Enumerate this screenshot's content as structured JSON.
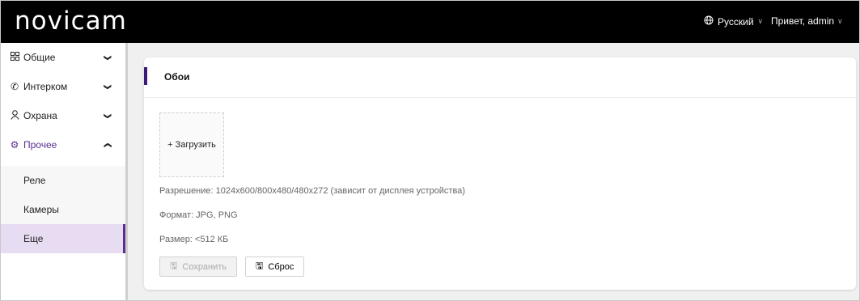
{
  "header": {
    "logo": "novicam",
    "language": "Русский",
    "greeting": "Привет, admin"
  },
  "sidebar": {
    "items": [
      {
        "label": "Общие",
        "icon": "grid-icon"
      },
      {
        "label": "Интерком",
        "icon": "handset-icon"
      },
      {
        "label": "Охрана",
        "icon": "person-icon"
      },
      {
        "label": "Прочее",
        "icon": "gear-icon"
      }
    ],
    "subitems": [
      {
        "label": "Реле"
      },
      {
        "label": "Камеры"
      },
      {
        "label": "Еще"
      }
    ]
  },
  "card": {
    "title": "Обои",
    "upload_label": "+ Загрузить",
    "resolution": "Разрешение: 1024x600/800x480/480x272 (зависит от дисплея устройства)",
    "format": "Формат: JPG, PNG",
    "size": "Размер: <512 КБ",
    "save_label": "Сохранить",
    "reset_label": "Сброс"
  },
  "colors": {
    "accent": "#5c2d91",
    "header_bg": "#000000",
    "selected_bg": "#e8dcf3"
  }
}
